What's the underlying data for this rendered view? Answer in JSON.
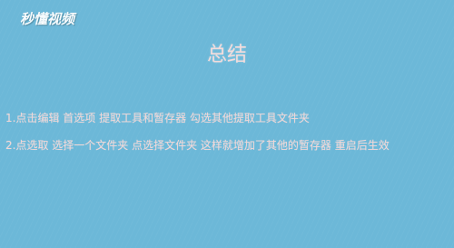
{
  "watermark": {
    "text": "秒懂视频"
  },
  "slide": {
    "title": "总结",
    "lines": [
      "1.点击编辑 首选项 提取工具和暂存器 勾选其他提取工具文件夹",
      "2.点选取 选择一个文件夹 点选择文件夹 这样就增加了其他的暂存器 重启后生效"
    ]
  },
  "colors": {
    "background": "#6cb8d8",
    "text": "#f1d7d7"
  }
}
